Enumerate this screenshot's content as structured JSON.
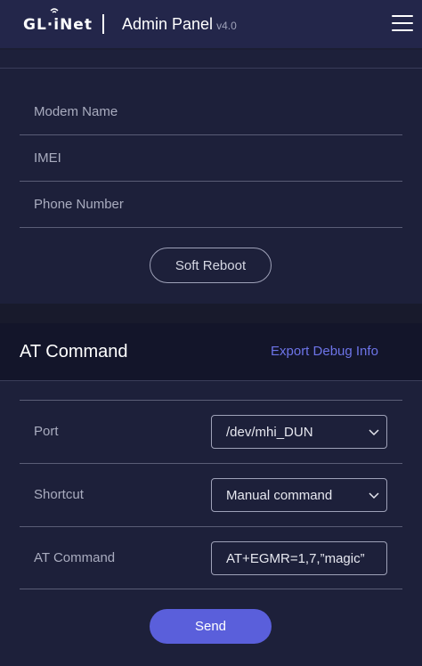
{
  "header": {
    "logo_text": "GL·iNet",
    "title": "Admin Panel",
    "version": "v4.0",
    "menu_icon": "hamburger-menu-icon"
  },
  "modem_info": {
    "fields": [
      {
        "label": "Modem Name"
      },
      {
        "label": "IMEI"
      },
      {
        "label": "Phone Number"
      }
    ],
    "soft_reboot_label": "Soft Reboot"
  },
  "at_command": {
    "title": "AT Command",
    "export_label": "Export Debug Info",
    "port": {
      "label": "Port",
      "value": "/dev/mhi_DUN"
    },
    "shortcut": {
      "label": "Shortcut",
      "value": "Manual command"
    },
    "command": {
      "label": "AT Command",
      "value": "AT+EGMR=1,7,”magic”"
    },
    "send_label": "Send"
  },
  "colors": {
    "accent": "#5a5fdb",
    "link": "#6d74e8",
    "background": "#1c1e33"
  }
}
